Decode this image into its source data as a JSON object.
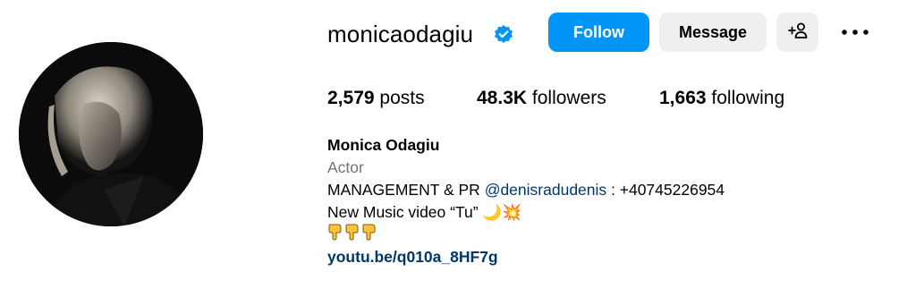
{
  "profile": {
    "username": "monicaodagiu",
    "verified": true,
    "follow_label": "Follow",
    "message_label": "Message",
    "posts_count": "2,579",
    "posts_label": "posts",
    "followers_count": "48.3K",
    "followers_label": "followers",
    "following_count": "1,663",
    "following_label": "following",
    "full_name": "Monica Odagiu",
    "category": "Actor",
    "bio_line1_prefix": "MANAGEMENT & PR ",
    "bio_mention": "@denisradudenis",
    "bio_line1_suffix": " : +40745226954",
    "bio_line2": "New Music video “Tu” 🌙💥",
    "bio_line3_icons": [
      "pointing-down-icon",
      "pointing-down-icon",
      "pointing-down-icon"
    ],
    "link": "youtu.be/q010a_8HF7g"
  },
  "colors": {
    "primary_button": "#0095f6",
    "secondary_button": "#efefef",
    "verified_badge": "#0095f6",
    "link": "#00376b",
    "muted": "#737373"
  }
}
